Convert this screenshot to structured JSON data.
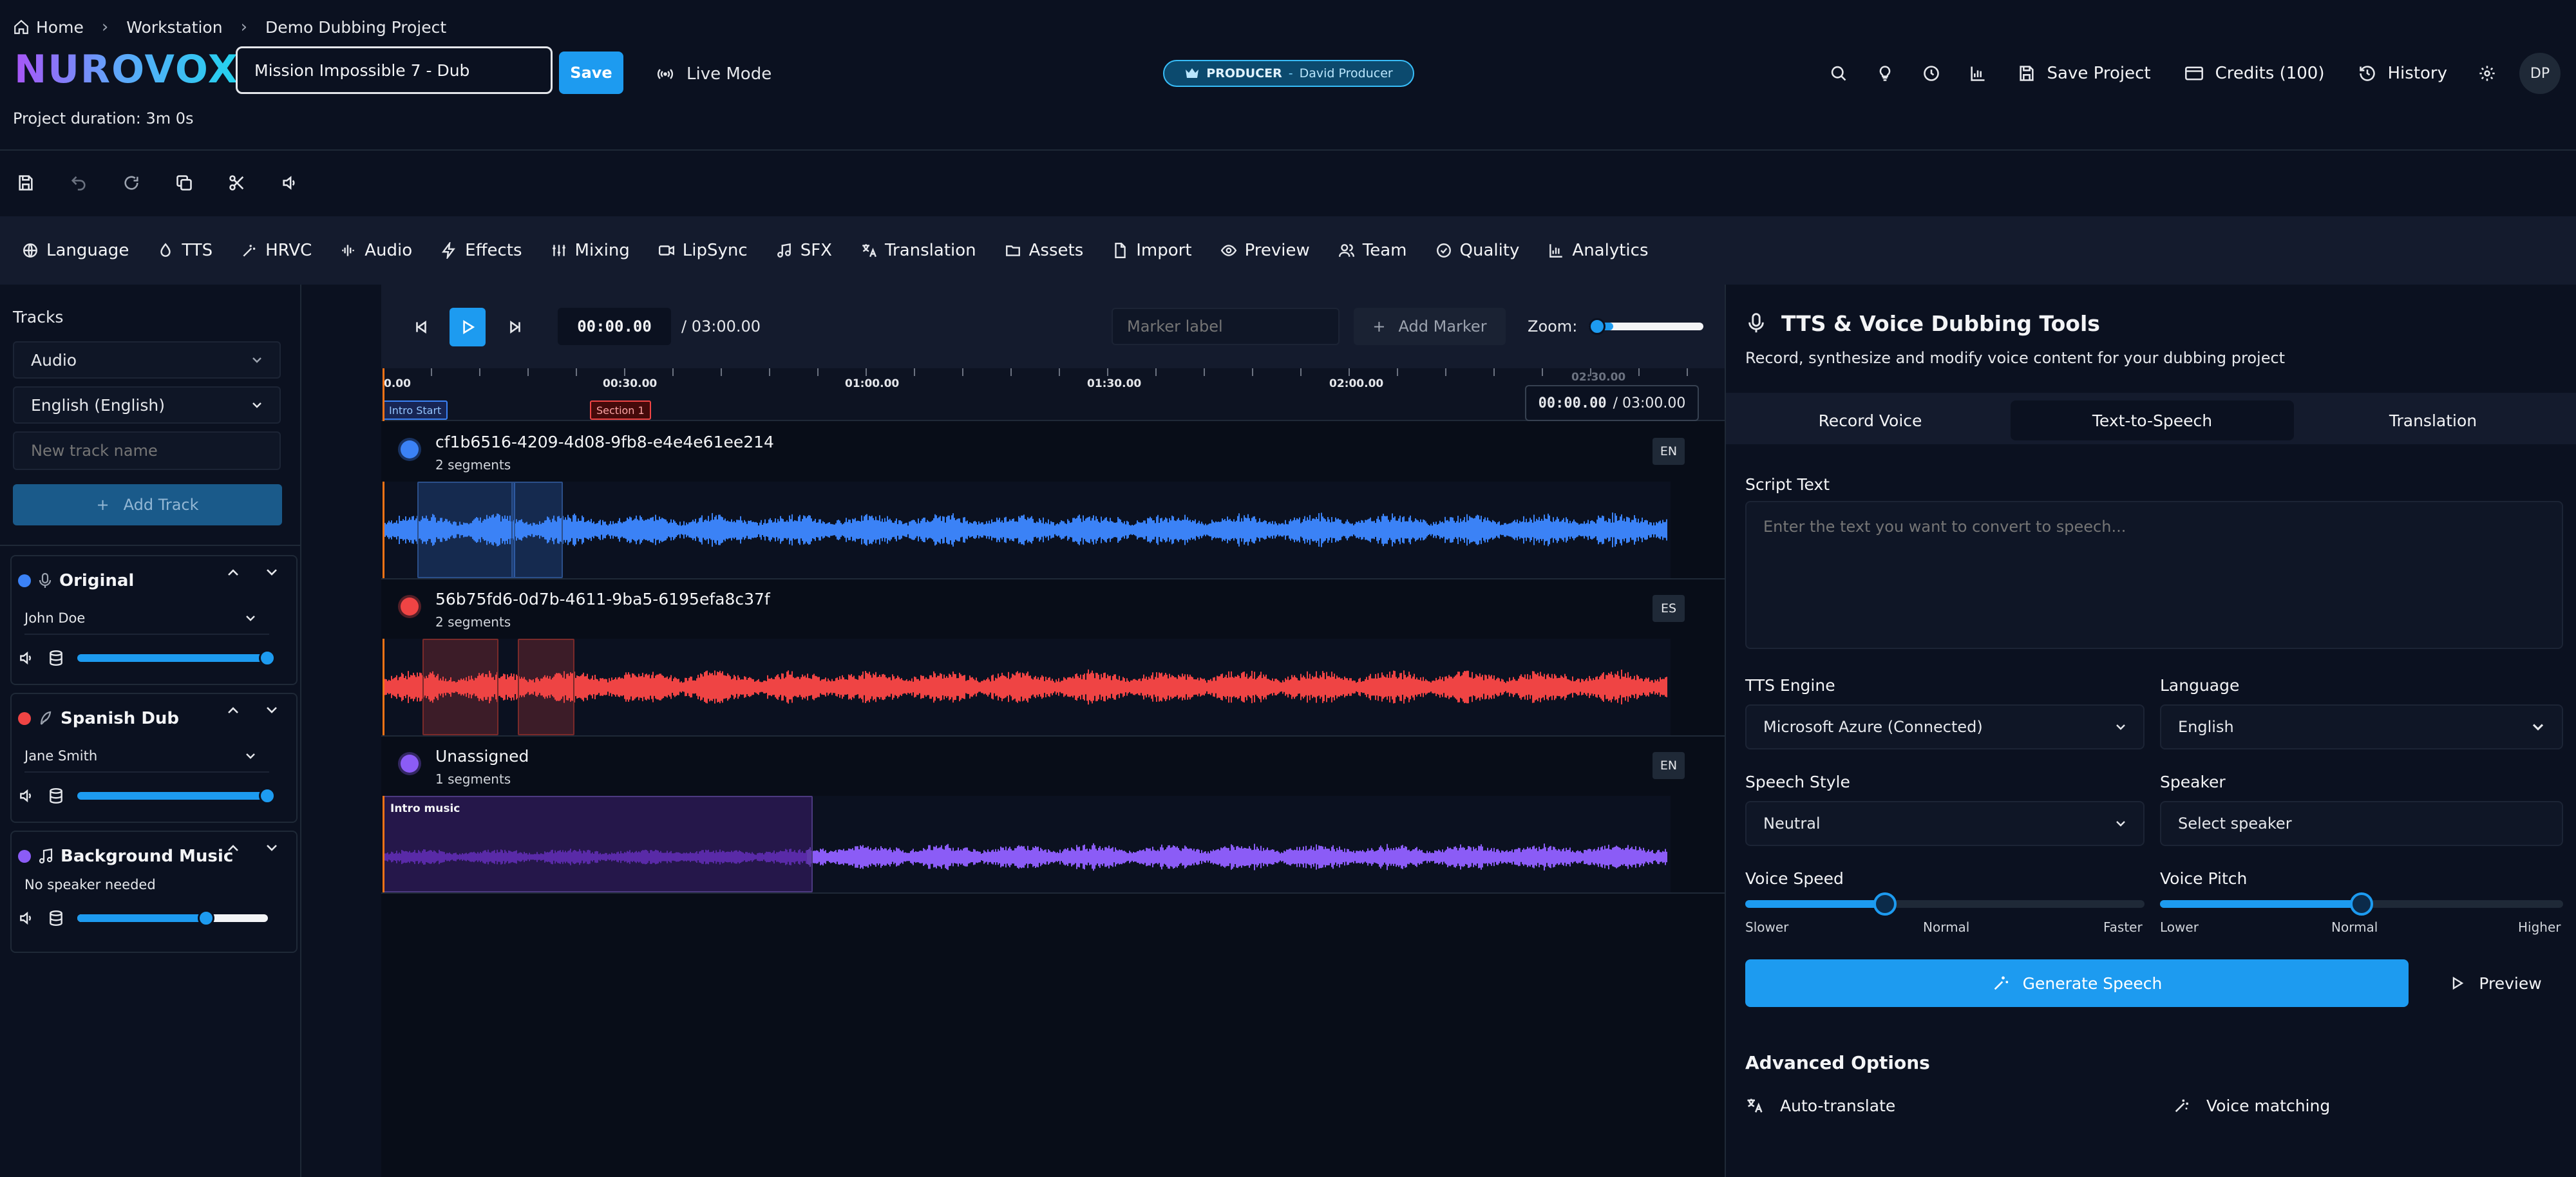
{
  "breadcrumb": {
    "home": "Home",
    "workstation": "Workstation",
    "project": "Demo Dubbing Project"
  },
  "brand": {
    "logo": "NUROVOX"
  },
  "header": {
    "project_name": "Mission Impossible 7 - Dub",
    "save_label": "Save",
    "live_mode_label": "Live Mode",
    "duration": "Project duration: 3m 0s",
    "role_badge": "PRODUCER",
    "role_user": "David Producer",
    "save_project_label": "Save Project",
    "credits_label": "Credits (100)",
    "history_label": "History",
    "avatar_initials": "DP"
  },
  "nav_tabs": [
    {
      "label": "Language",
      "icon": "globe-icon"
    },
    {
      "label": "TTS",
      "icon": "droplet-icon"
    },
    {
      "label": "HRVC",
      "icon": "wand-icon"
    },
    {
      "label": "Audio",
      "icon": "waveform-icon"
    },
    {
      "label": "Effects",
      "icon": "zap-icon"
    },
    {
      "label": "Mixing",
      "icon": "sliders-icon"
    },
    {
      "label": "LipSync",
      "icon": "video-icon"
    },
    {
      "label": "SFX",
      "icon": "music-note-icon"
    },
    {
      "label": "Translation",
      "icon": "translate-icon"
    },
    {
      "label": "Assets",
      "icon": "folder-icon"
    },
    {
      "label": "Import",
      "icon": "file-icon"
    },
    {
      "label": "Preview",
      "icon": "eye-icon"
    },
    {
      "label": "Team",
      "icon": "users-icon"
    },
    {
      "label": "Quality",
      "icon": "check-circle-icon"
    },
    {
      "label": "Analytics",
      "icon": "bar-chart-icon"
    }
  ],
  "left": {
    "tracks_label": "Tracks",
    "type_select": "Audio",
    "lang_select": "English (English)",
    "new_track_placeholder": "New track name",
    "add_track_label": "Add Track",
    "cards": [
      {
        "name": "Original",
        "speaker": "John Doe",
        "color": "#3b82f6",
        "volume": 1.0
      },
      {
        "name": "Spanish Dub",
        "speaker": "Jane Smith",
        "color": "#ef4444",
        "volume": 1.0
      },
      {
        "name": "Background Music",
        "speaker": "No speaker needed",
        "color": "#8b5cf6",
        "volume": 0.68
      }
    ]
  },
  "timeline": {
    "current_time": "00:00.00",
    "total_time": "/ 03:00.00",
    "marker_placeholder": "Marker label",
    "add_marker_label": "Add Marker",
    "zoom_label": "Zoom:",
    "ruler_labels": [
      "0.00",
      "00:30.00",
      "01:00.00",
      "01:30.00",
      "02:00.00",
      "02:30.00"
    ],
    "markers": [
      "Intro Start",
      "Section 1"
    ],
    "playhead_time": "00:00.00",
    "playhead_total": "/ 03:00.00",
    "tracks": [
      {
        "id": "cf1b6516-4209-4d08-9fb8-e4e4e61ee214",
        "segments": "2 segments",
        "lang": "EN",
        "color": "#3b82f6"
      },
      {
        "id": "56b75fd6-0d7b-4611-9ba5-6195efa8c37f",
        "segments": "2 segments",
        "lang": "ES",
        "color": "#ef4444"
      },
      {
        "id": "Unassigned",
        "segments": "1 segments",
        "lang": "EN",
        "color": "#8b5cf6",
        "clip_label": "Intro music"
      }
    ]
  },
  "right": {
    "title": "TTS & Voice Dubbing Tools",
    "subtitle": "Record, synthesize and modify voice content for your dubbing project",
    "tabs": [
      "Record Voice",
      "Text-to-Speech",
      "Translation"
    ],
    "script_label": "Script Text",
    "script_placeholder": "Enter the text you want to convert to speech...",
    "engine_label": "TTS Engine",
    "engine_value": "Microsoft Azure (Connected)",
    "language_label": "Language",
    "language_value": "English",
    "style_label": "Speech Style",
    "style_value": "Neutral",
    "speaker_label": "Speaker",
    "speaker_value": "Select speaker",
    "speed_label": "Voice Speed",
    "speed_scale": [
      "Slower",
      "Normal",
      "Faster"
    ],
    "speed_value": 0.35,
    "pitch_label": "Voice Pitch",
    "pitch_scale": [
      "Lower",
      "Normal",
      "Higher"
    ],
    "pitch_value": 0.5,
    "generate_label": "Generate Speech",
    "preview_label": "Preview",
    "advanced_label": "Advanced Options",
    "auto_translate_label": "Auto-translate",
    "voice_matching_label": "Voice matching"
  },
  "colors": {
    "accent": "#1d9bf0",
    "blue": "#3b82f6",
    "red": "#ef4444",
    "purple": "#8b5cf6"
  }
}
